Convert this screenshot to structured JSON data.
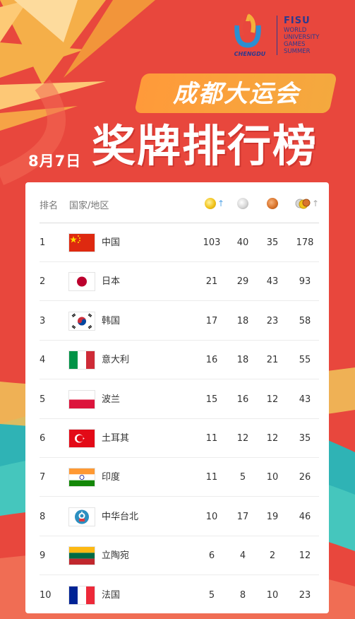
{
  "logo": {
    "city": "CHENGDU",
    "org": "FISU",
    "lines": [
      "WORLD",
      "UNIVERSITY",
      "GAMES",
      "SUMMER"
    ]
  },
  "banner": "成都大运会",
  "date": "8月7日",
  "title": "奖牌排行榜",
  "table": {
    "headers": {
      "rank": "排名",
      "country": "国家/地区",
      "gold_icon": "gold-medal-icon",
      "silver_icon": "silver-medal-icon",
      "bronze_icon": "bronze-medal-icon",
      "total_icon": "medals-total-icon",
      "sort_arrow": "↑"
    },
    "rows": [
      {
        "rank": "1",
        "name": "中国",
        "flag": "china",
        "gold": "103",
        "silver": "40",
        "bronze": "35",
        "total": "178"
      },
      {
        "rank": "2",
        "name": "日本",
        "flag": "japan",
        "gold": "21",
        "silver": "29",
        "bronze": "43",
        "total": "93"
      },
      {
        "rank": "3",
        "name": "韩国",
        "flag": "korea",
        "gold": "17",
        "silver": "18",
        "bronze": "23",
        "total": "58"
      },
      {
        "rank": "4",
        "name": "意大利",
        "flag": "italy",
        "gold": "16",
        "silver": "18",
        "bronze": "21",
        "total": "55"
      },
      {
        "rank": "5",
        "name": "波兰",
        "flag": "poland",
        "gold": "15",
        "silver": "16",
        "bronze": "12",
        "total": "43"
      },
      {
        "rank": "6",
        "name": "土耳其",
        "flag": "turkey",
        "gold": "11",
        "silver": "12",
        "bronze": "12",
        "total": "35"
      },
      {
        "rank": "7",
        "name": "印度",
        "flag": "india",
        "gold": "11",
        "silver": "5",
        "bronze": "10",
        "total": "26"
      },
      {
        "rank": "8",
        "name": "中华台北",
        "flag": "chinese-taipei",
        "gold": "10",
        "silver": "17",
        "bronze": "19",
        "total": "46"
      },
      {
        "rank": "9",
        "name": "立陶宛",
        "flag": "lithuania",
        "gold": "6",
        "silver": "4",
        "bronze": "2",
        "total": "12"
      },
      {
        "rank": "10",
        "name": "法国",
        "flag": "france",
        "gold": "5",
        "silver": "8",
        "bronze": "10",
        "total": "23"
      }
    ]
  },
  "colors": {
    "background": "#e8473d",
    "accent_orange": "#f4a93e",
    "logo_blue": "#2b3a8f",
    "teal": "#2fb3b5"
  }
}
